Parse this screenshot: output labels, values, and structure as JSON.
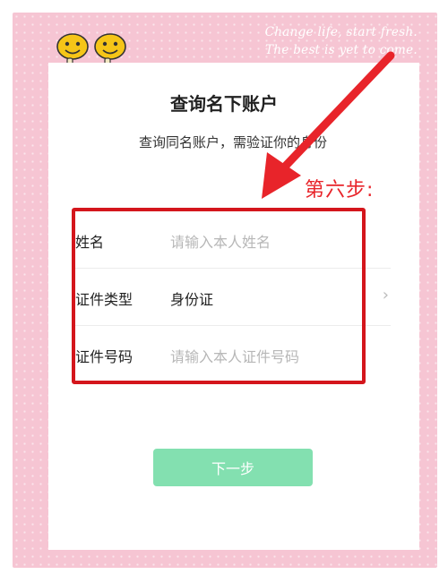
{
  "decor": {
    "tagline_line1": "Change life, start fresh.",
    "tagline_line2": "The best is yet to come.",
    "step_label": "第六步:",
    "frame_color": "#f6c5d3",
    "highlight_color": "#d4161c"
  },
  "page": {
    "title": "查询名下账户",
    "subtitle": "查询同名账户，需验证你的身份"
  },
  "form": {
    "name": {
      "label": "姓名",
      "placeholder": "请输入本人姓名"
    },
    "id_type": {
      "label": "证件类型",
      "value": "身份证",
      "chevron_icon": "chevron-right-icon"
    },
    "id_number": {
      "label": "证件号码",
      "placeholder": "请输入本人证件号码"
    }
  },
  "actions": {
    "next_label": "下一步",
    "next_color": "#83e0b0"
  }
}
